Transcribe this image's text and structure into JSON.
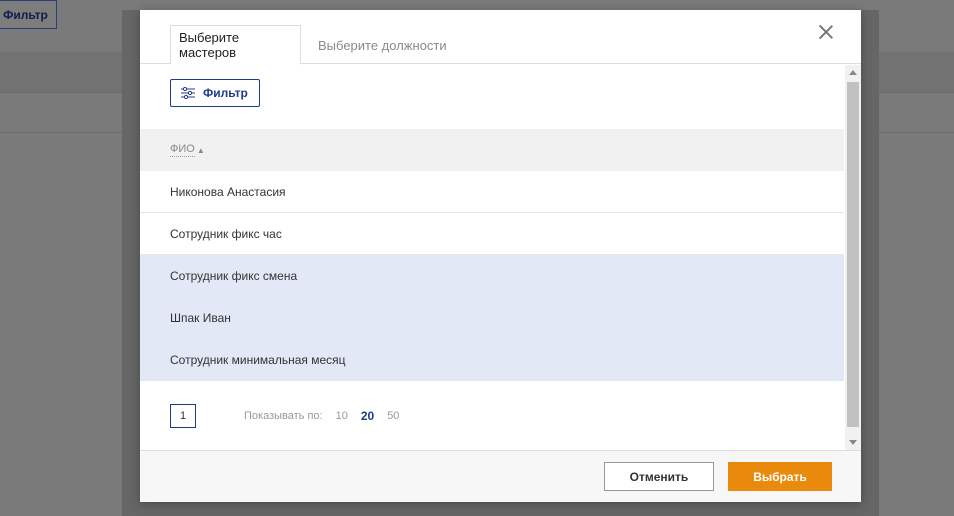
{
  "background": {
    "filter_label": "Фильтр"
  },
  "modal": {
    "tabs": [
      {
        "label": "Выберите мастеров",
        "active": true
      },
      {
        "label": "Выберите должности",
        "active": false
      }
    ],
    "filter_button": "Фильтр",
    "table": {
      "column_header": "ФИО",
      "rows": [
        {
          "name": "Никонова Анастасия",
          "selected": false
        },
        {
          "name": "Сотрудник фикс час",
          "selected": false
        },
        {
          "name": "Сотрудник фикс смена",
          "selected": true
        },
        {
          "name": "Шпак Иван",
          "selected": true
        },
        {
          "name": "Сотрудник минимальная месяц",
          "selected": true
        }
      ]
    },
    "pagination": {
      "current_page": "1",
      "show_label": "Показывать по:",
      "page_sizes": [
        "10",
        "20",
        "50"
      ],
      "active_size": "20"
    },
    "footer": {
      "cancel_label": "Отменить",
      "select_label": "Выбрать"
    }
  },
  "colors": {
    "accent": "#1f3c88",
    "primary_button": "#ea8a0c",
    "selected_row": "#e3e8f7"
  }
}
